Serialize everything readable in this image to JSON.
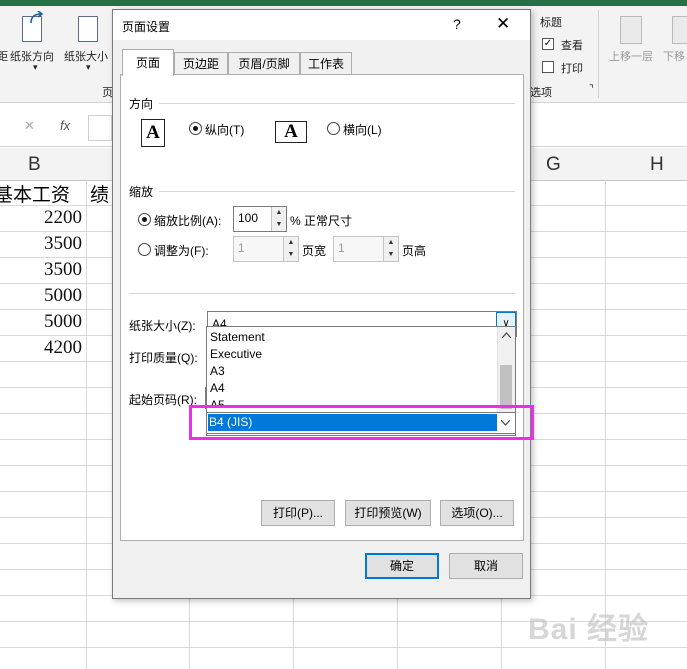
{
  "excel": {
    "ribbon": {
      "left_cut_label": "距",
      "orientation_label": "纸张方向",
      "size_label": "纸张大小",
      "group_cut_label": "页",
      "title_group": "标题",
      "view_label": "查看",
      "print_label": "打印",
      "options_cut": "选项",
      "bring_forward": "上移一层",
      "send_backward": "下移",
      "dropdown_marker": "▾",
      "launcher_icon": "⌝"
    },
    "formula_bar": {
      "cancel_icon": "✕",
      "confirm_icon": "✓",
      "fx_label": "fx"
    },
    "columns": {
      "b": "B",
      "g": "G",
      "h": "H"
    },
    "cells": {
      "b1": "基本工资",
      "c1": "绩",
      "b_values": [
        "2200",
        "3500",
        "3500",
        "5000",
        "5000",
        "4200"
      ]
    },
    "watermark": "Bai 经验"
  },
  "dialog": {
    "title": "页面设置",
    "help": "?",
    "close": "✕",
    "tabs": [
      "页面",
      "页边距",
      "页眉/页脚",
      "工作表"
    ],
    "orientation": {
      "section": "方向",
      "page_glyph": "A",
      "portrait": "纵向(T)",
      "landscape": "横向(L)",
      "selected": "portrait"
    },
    "scaling": {
      "section": "缩放",
      "adjust_to": "缩放比例(A):",
      "adjust_value": "100",
      "adjust_suffix": "% 正常尺寸",
      "fit_to": "调整为(F):",
      "fit_wide_value": "1",
      "fit_wide_label": "页宽",
      "fit_tall_value": "1",
      "fit_tall_label": "页高",
      "selected": "adjust"
    },
    "paper_size": {
      "label": "纸张大小(Z):",
      "value": "A4",
      "options": [
        "Statement",
        "Executive",
        "A3",
        "A4",
        "A5"
      ],
      "highlighted_option": "B4 (JIS)"
    },
    "print_quality_label": "打印质量(Q):",
    "first_page_label": "起始页码(R):",
    "buttons": {
      "print": "打印(P)...",
      "preview": "打印预览(W)",
      "options": "选项(O)...",
      "ok": "确定",
      "cancel": "取消"
    }
  },
  "colors": {
    "accent": "#0078d7",
    "highlight_box": "#e632e6",
    "excel_green": "#217346"
  }
}
